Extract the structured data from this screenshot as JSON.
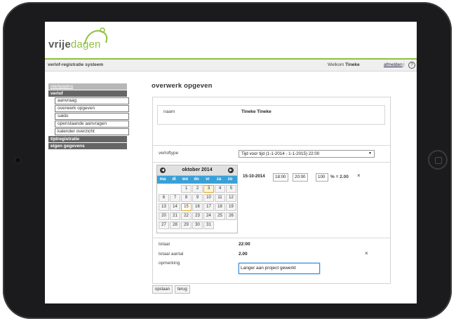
{
  "brand": {
    "part1": "vrije",
    "part2": "dagen"
  },
  "topbar": {
    "app_name": "verlof-registratie systeem",
    "welcome": "Welkom",
    "user": "Tineke",
    "logout": "afmelden",
    "separator": "|",
    "help": "?"
  },
  "sidebar": {
    "items": [
      {
        "label": "startpagina",
        "style": "light"
      },
      {
        "label": "verlof",
        "style": "dark"
      }
    ],
    "subitems": [
      "aanvraag",
      "overwerk opgeven",
      "saldo",
      "openstaande aanvragen",
      "kalender overzicht"
    ],
    "items2": [
      {
        "label": "tijdregistratie"
      },
      {
        "label": "eigen gegevens"
      }
    ]
  },
  "page": {
    "title": "overwerk opgeven"
  },
  "form": {
    "name_label": "naam",
    "name_value": "Tineke Tineke",
    "type_label": "verloftype",
    "type_value": "Tijd voor tijd (1-1-2014 - 1-1-2015)  22:00",
    "date": "15-10-2014",
    "from_time": "18:00",
    "to_time": "20:00",
    "percent": "100",
    "percent_result": "% = 2.00",
    "total_label": "totaal",
    "total_value": "22:00",
    "total_count_label": "totaal aantal",
    "total_count_value": "2.00",
    "remark_label": "opmerking",
    "remark_value": "Langer aan project gewerkt",
    "remove_icon": "×"
  },
  "calendar": {
    "month": "oktober 2014",
    "prev": "◀",
    "next": "▶",
    "dow": [
      "ma",
      "di",
      "wo",
      "do",
      "vr",
      "za",
      "zo"
    ],
    "weeks": [
      [
        "",
        "",
        "1",
        "2",
        "3",
        "4",
        "5"
      ],
      [
        "6",
        "7",
        "8",
        "9",
        "10",
        "11",
        "12"
      ],
      [
        "13",
        "14",
        "15",
        "16",
        "17",
        "18",
        "19"
      ],
      [
        "20",
        "21",
        "22",
        "23",
        "24",
        "25",
        "26"
      ],
      [
        "27",
        "28",
        "29",
        "30",
        "31",
        "",
        ""
      ]
    ],
    "today": "3",
    "selected": "15"
  },
  "buttons": {
    "save": "opslaan",
    "back": "terug"
  },
  "colors": {
    "brand_green": "#8fc13e",
    "calendar_header": "#3aa0d8",
    "sidebar_dark": "#666666",
    "sidebar_light": "#b7b7b7"
  }
}
